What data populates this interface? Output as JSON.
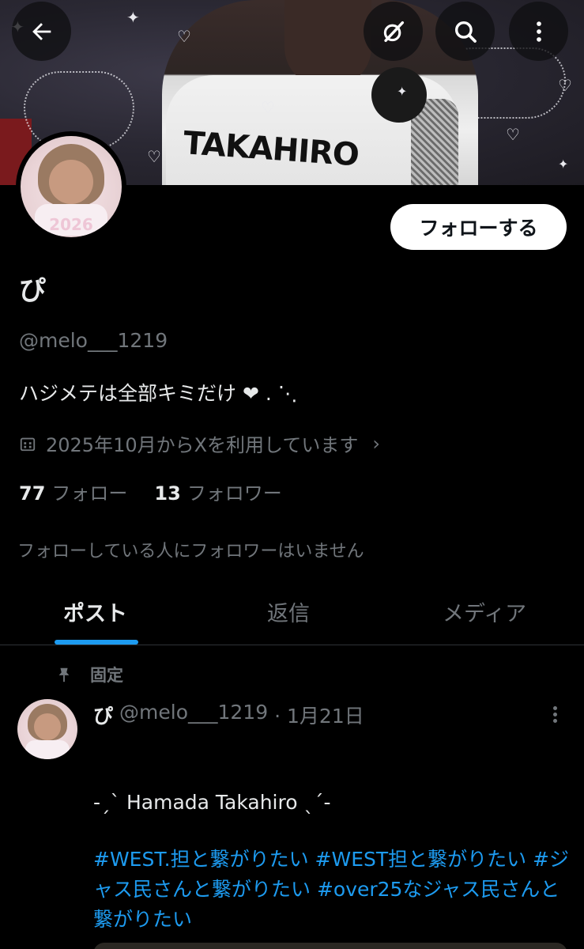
{
  "banner": {
    "shirt_print": "TAKAHIRO"
  },
  "top_bar": {
    "back_icon": "arrow-left-icon",
    "grok_icon": "grok-icon",
    "search_icon": "search-icon",
    "more_icon": "more-vertical-icon"
  },
  "profile": {
    "follow_label": "フォローする",
    "name": "ぴ",
    "handle": "@melo___1219",
    "bio": "ハジメテは全部キミだけ ❤︎ . ⋱",
    "joined": "2025年10月からXを利用しています",
    "following_count": "77",
    "following_label": "フォロー",
    "followers_count": "13",
    "followers_label": "フォロワー",
    "mutual_note": "フォローしている人にフォロワーはいません",
    "avatar_year": "2026"
  },
  "tabs": [
    {
      "label": "ポスト",
      "active": true
    },
    {
      "label": "返信",
      "active": false
    },
    {
      "label": "メディア",
      "active": false
    }
  ],
  "post": {
    "pinned_label": "固定",
    "name": "ぴ",
    "handle": "@melo___1219",
    "date": "· 1月21日",
    "line": "-ˏˋ Hamada Takahiro ˎˊ-",
    "hashtags": "#WEST.担と繋がりたい #WEST担と繋がりたい #ジャス民さんと繋がりたい #over25なジャス民さんと繋がりたい"
  },
  "colors": {
    "background": "#000000",
    "accent": "#1d9bf0",
    "secondary_text": "#71767b",
    "primary_text": "#e7e9ea"
  }
}
